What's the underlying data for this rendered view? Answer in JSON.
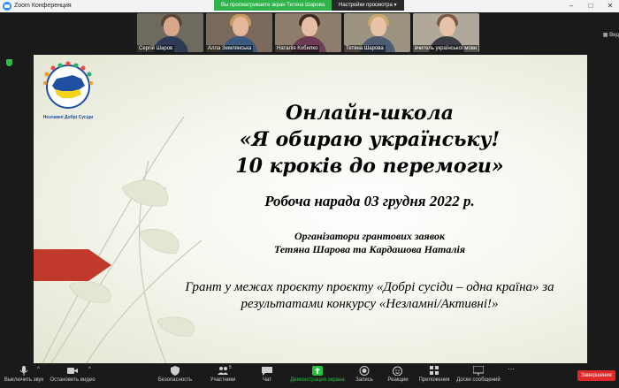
{
  "window": {
    "title": "Zoom Конференция",
    "controls": [
      "–",
      "□",
      "✕"
    ]
  },
  "share_bar": {
    "viewing": "Вы просматриваете экран Тетяна Шарова",
    "options": "Настройки просмотра",
    "options_icon": "chevron-down-icon"
  },
  "participants": [
    {
      "name": "Сергій Шаров",
      "bg": "#6f6a5e",
      "skin": "#d9a78a",
      "hair": "#5b4636",
      "clothes": "#2e3b55"
    },
    {
      "name": "Алла Землянська",
      "bg": "#7b6a5c",
      "skin": "#e2b79b",
      "hair": "#c99a5e",
      "clothes": "#3a5a80"
    },
    {
      "name": "Наталія Кобилко",
      "bg": "#8f7d6b",
      "skin": "#e6c0a6",
      "hair": "#3e2a20",
      "clothes": "#6d3c54"
    },
    {
      "name": "Тетяна Шарова",
      "bg": "#9d9381",
      "skin": "#e8c3a8",
      "hair": "#c9a870",
      "clothes": "#4c5c73"
    },
    {
      "name": "вчитель української мови",
      "bg": "#b0a89a",
      "skin": "#e5c2a8",
      "hair": "#7b5a46",
      "clothes": "#3c3c45"
    }
  ],
  "side_toggle": "Вид",
  "slide": {
    "title_line1": "Онлайн-школа",
    "title_line2": "«Я обираю українську!",
    "title_line3": "10 кроків до перемоги»",
    "meeting": "Робоча нарада 03 грудня 2022 р.",
    "organizers_label": "Організатори грантових заявок",
    "organizers_names": "Тетяна Шарова та Кардашова Наталія",
    "grant_line1": "Грант у межах проєкту проєкту «Добрі сусіди – одна країна» за",
    "grant_line2": "результатами конкурсу «Незламні/Активні!»",
    "logo_text": "Незламні Добрі Сусіди",
    "colors": {
      "arrow": "#c0392b",
      "blue": "#1f4fa0",
      "yellow": "#f5d21c"
    }
  },
  "toolbar": {
    "mute": "Выключить звук",
    "video": "Остановить видео",
    "security": "Безопасность",
    "participants": "Участники",
    "participants_count": "5",
    "chat": "Чат",
    "share": "Демонстрация экрана",
    "record": "Запись",
    "reactions": "Реакции",
    "apps": "Приложения",
    "whiteboards": "Доски сообщений",
    "end": "Завершение"
  }
}
